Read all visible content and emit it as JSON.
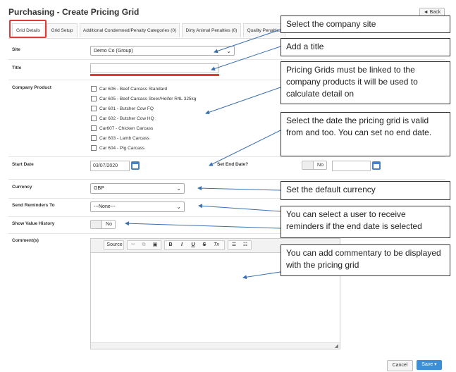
{
  "header": {
    "title": "Purchasing - Create Pricing Grid",
    "back_label": "◄ Back"
  },
  "tabs": [
    {
      "label": "Grid Details"
    },
    {
      "label": "Grid Setup"
    },
    {
      "label": "Additional Condemned/Penalty Categories (0)"
    },
    {
      "label": "Dirty Animal Penalties (0)"
    },
    {
      "label": "Quality Penalties"
    }
  ],
  "form": {
    "site_label": "Site",
    "site_value": "Demo Co (Group)",
    "title_label": "Title",
    "title_value": "",
    "product_label": "Company Product",
    "products": [
      "Car 606 - Beef Carcass Standard",
      "Car 605 - Beef Carcass Steer/Heifer R4L 325kg",
      "Car 601 - Butcher Cow FQ",
      "Car 602 - Butcher Cow HQ",
      "Car607 - Chicken Carcass",
      "Car 603 - Lamb Carcass",
      "Car 604 - Pig Carcass"
    ],
    "start_date_label": "Start Date",
    "start_date_value": "03/07/2020",
    "set_end_date_label": "Set End Date?",
    "end_toggle_value": "No",
    "currency_label": "Currency",
    "currency_value": "GBP",
    "reminders_label": "Send Reminders To",
    "reminders_value": "---None---",
    "value_history_label": "Show Value History",
    "value_history_value": "No",
    "comments_label": "Comment(s)"
  },
  "editor": {
    "source_label": "Source",
    "bold": "B",
    "italic": "I",
    "underline": "U",
    "strike": "S",
    "clear": "Tx"
  },
  "callouts": [
    "Select the company site",
    "Add a title",
    "Pricing Grids must be linked to the company products it will be used to calculate detail on",
    "Select the date the pricing grid is valid from and too. You can set no end date.",
    "Set the default currency",
    "You can select a user to receive reminders if the end date is selected",
    "You can add commentary to be displayed with the pricing grid"
  ],
  "footer": {
    "cancel_label": "Cancel",
    "save_label": "Save ▾"
  },
  "colors": {
    "highlight": "#e53935",
    "accent": "#3b8fd8",
    "arrow": "#3a6fb0"
  }
}
